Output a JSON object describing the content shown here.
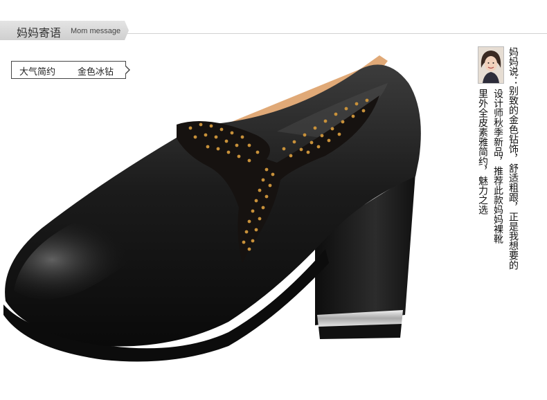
{
  "header": {
    "title": "妈妈寄语",
    "subtitle": "Mom message"
  },
  "tag": {
    "left": "大气简约",
    "right": "金色冰钻"
  },
  "product": {
    "image_label": "black leather high-heel ankle shoe with gold studded butterfly ornament"
  },
  "mom_note": {
    "col_1": "妈妈说：别致的金色钻饰，舒适粗跟，正是我想要的",
    "col_2": "设计师秋季新品，推荐此款妈妈裸靴",
    "col_3": "里外全皮素雅简约，魅力之选"
  },
  "colors": {
    "leather": "#1a1a1a",
    "gold": "#c8913a",
    "lining": "#e0a977"
  }
}
